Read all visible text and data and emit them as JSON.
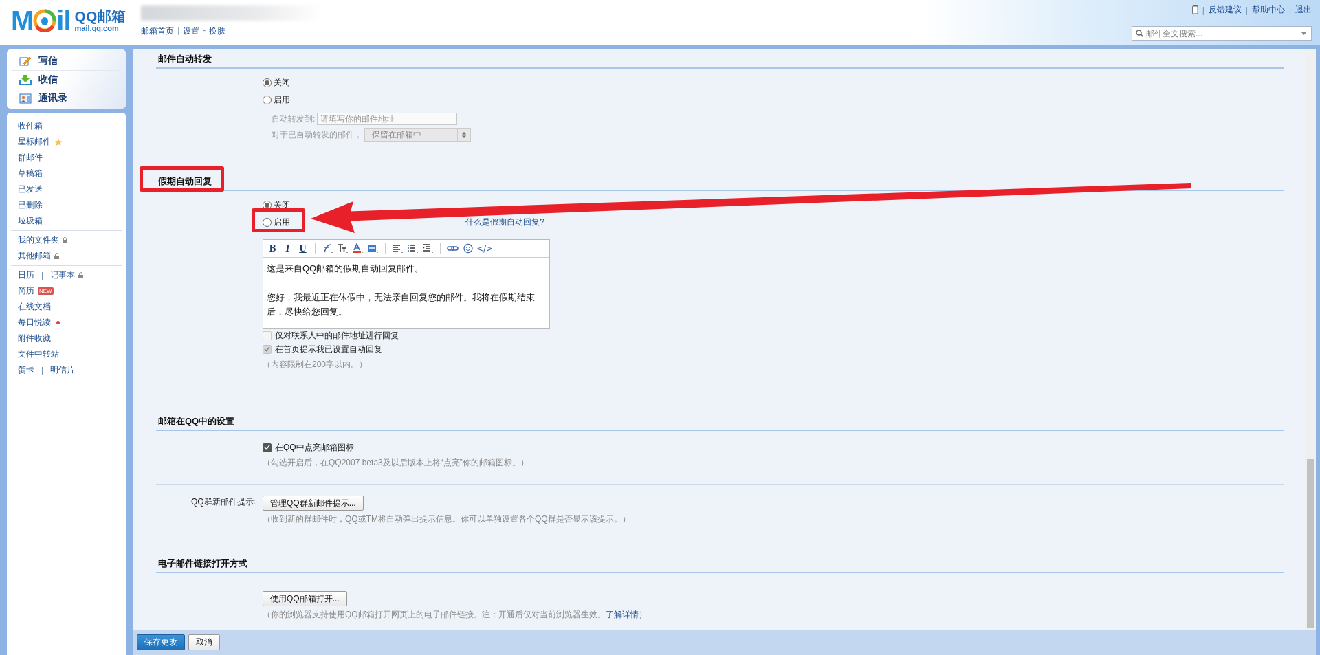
{
  "header": {
    "logo": {
      "wordmark_start": "M",
      "wordmark_end": "il",
      "title": "QQ邮箱",
      "domain": "mail.qq.com"
    },
    "nav_links": [
      {
        "label": "邮箱首页",
        "separator": "|"
      },
      {
        "label": "设置",
        "separator": "-"
      },
      {
        "label": "换肤"
      }
    ],
    "top_links": [
      {
        "label": "反馈建议"
      },
      {
        "label": "帮助中心"
      },
      {
        "label": "退出"
      }
    ],
    "separator": "|",
    "search": {
      "placeholder": "邮件全文搜索..."
    }
  },
  "sidebar": {
    "actions": [
      {
        "kind": "compose",
        "label": "写信"
      },
      {
        "kind": "receive",
        "label": "收信"
      },
      {
        "kind": "contacts",
        "label": "通讯录"
      }
    ],
    "groups": [
      [
        {
          "links": [
            "收件箱"
          ]
        },
        {
          "links": [
            "星标邮件"
          ],
          "marker": {
            "kind": "star"
          }
        },
        {
          "links": [
            "群邮件"
          ]
        },
        {
          "links": [
            "草稿箱"
          ]
        },
        {
          "links": [
            "已发送"
          ]
        },
        {
          "links": [
            "已删除"
          ]
        },
        {
          "links": [
            "垃圾箱"
          ]
        }
      ],
      [
        {
          "links": [
            "我的文件夹"
          ],
          "marker": {
            "kind": "lock"
          }
        },
        {
          "links": [
            "其他邮箱"
          ],
          "marker": {
            "kind": "lock"
          }
        }
      ],
      [
        {
          "links": [
            "日历",
            "记事本"
          ],
          "separator": "|",
          "marker": {
            "kind": "lock"
          }
        },
        {
          "links": [
            "简历"
          ],
          "marker": {
            "kind": "new",
            "text": "NEW"
          }
        },
        {
          "links": [
            "在线文档"
          ]
        },
        {
          "links": [
            "每日悦读"
          ],
          "marker": {
            "kind": "dot"
          }
        },
        {
          "links": [
            "附件收藏"
          ]
        },
        {
          "links": [
            "文件中转站"
          ]
        },
        {
          "links": [
            "贺卡",
            "明信片"
          ],
          "separator": "|"
        }
      ]
    ]
  },
  "sections": [
    {
      "heading": "邮件自动转发",
      "rows": [
        {
          "kind": "radio_group",
          "options": [
            {
              "label": "关闭",
              "selected": true
            },
            {
              "label": "启用",
              "selected": false
            }
          ]
        },
        {
          "kind": "forward_fields",
          "disabled": true,
          "address_label": "自动转发到:",
          "address_placeholder": "请填写你的邮件地址",
          "select_label": "对于已自动转发的邮件，",
          "select_value": "保留在邮箱中"
        }
      ]
    },
    {
      "heading": "假期自动回复",
      "highlighted": true,
      "rows": [
        {
          "kind": "radio_group",
          "options": [
            {
              "label": "关闭",
              "selected": true
            },
            {
              "label": "启用",
              "selected": false,
              "highlighted": true,
              "link": "什么是假期自动回复?"
            }
          ]
        },
        {
          "kind": "editor",
          "toolbar": [
            {
              "kind": "bold",
              "label": "B"
            },
            {
              "kind": "italic",
              "label": "I"
            },
            {
              "kind": "underline",
              "label": "U"
            },
            {
              "kind": "separator"
            },
            {
              "kind": "font"
            },
            {
              "kind": "size"
            },
            {
              "kind": "color"
            },
            {
              "kind": "highlight"
            },
            {
              "kind": "separator"
            },
            {
              "kind": "align"
            },
            {
              "kind": "list"
            },
            {
              "kind": "indent"
            },
            {
              "kind": "separator"
            },
            {
              "kind": "link"
            },
            {
              "kind": "emoji"
            },
            {
              "kind": "code",
              "label": "</>"
            }
          ],
          "paragraphs": [
            "这是来自QQ邮箱的假期自动回复邮件。",
            "您好，我最近正在休假中，无法亲自回复您的邮件。我将在假期结束后，尽快给您回复。"
          ]
        },
        {
          "kind": "checkbox",
          "label": "仅对联系人中的邮件地址进行回复",
          "checked": false,
          "disabled": true
        },
        {
          "kind": "checkbox",
          "label": "在首页提示我已设置自动回复",
          "checked": true,
          "disabled": true
        },
        {
          "kind": "note",
          "text": "（内容限制在200字以内。）"
        }
      ]
    },
    {
      "heading": "邮箱在QQ中的设置",
      "rows": [
        {
          "kind": "checkbox",
          "label": "在QQ中点亮邮箱图标",
          "checked": true,
          "disabled": false
        },
        {
          "kind": "note",
          "text": "（勾选开启后，在QQ2007 beta3及以后版本上将“点亮”你的邮箱图标。）"
        },
        {
          "kind": "divider"
        },
        {
          "kind": "button",
          "label": "QQ群新邮件提示:",
          "button": "管理QQ群新邮件提示..."
        },
        {
          "kind": "note",
          "text": "（收到新的群邮件时，QQ或TM将自动弹出提示信息。你可以单独设置各个QQ群是否显示该提示。）"
        }
      ]
    },
    {
      "heading": "电子邮件链接打开方式",
      "rows": [
        {
          "kind": "button",
          "button": "使用QQ邮箱打开..."
        },
        {
          "kind": "note",
          "text": "（你的浏览器支持使用QQ邮箱打开网页上的电子邮件链接。注：开通后仅对当前浏览器生效。",
          "link": "了解详情",
          "suffix": "）"
        }
      ]
    }
  ],
  "footer": {
    "buttons": [
      {
        "kind": "primary",
        "label": "保存更改"
      },
      {
        "kind": "secondary",
        "label": "取消"
      }
    ]
  }
}
